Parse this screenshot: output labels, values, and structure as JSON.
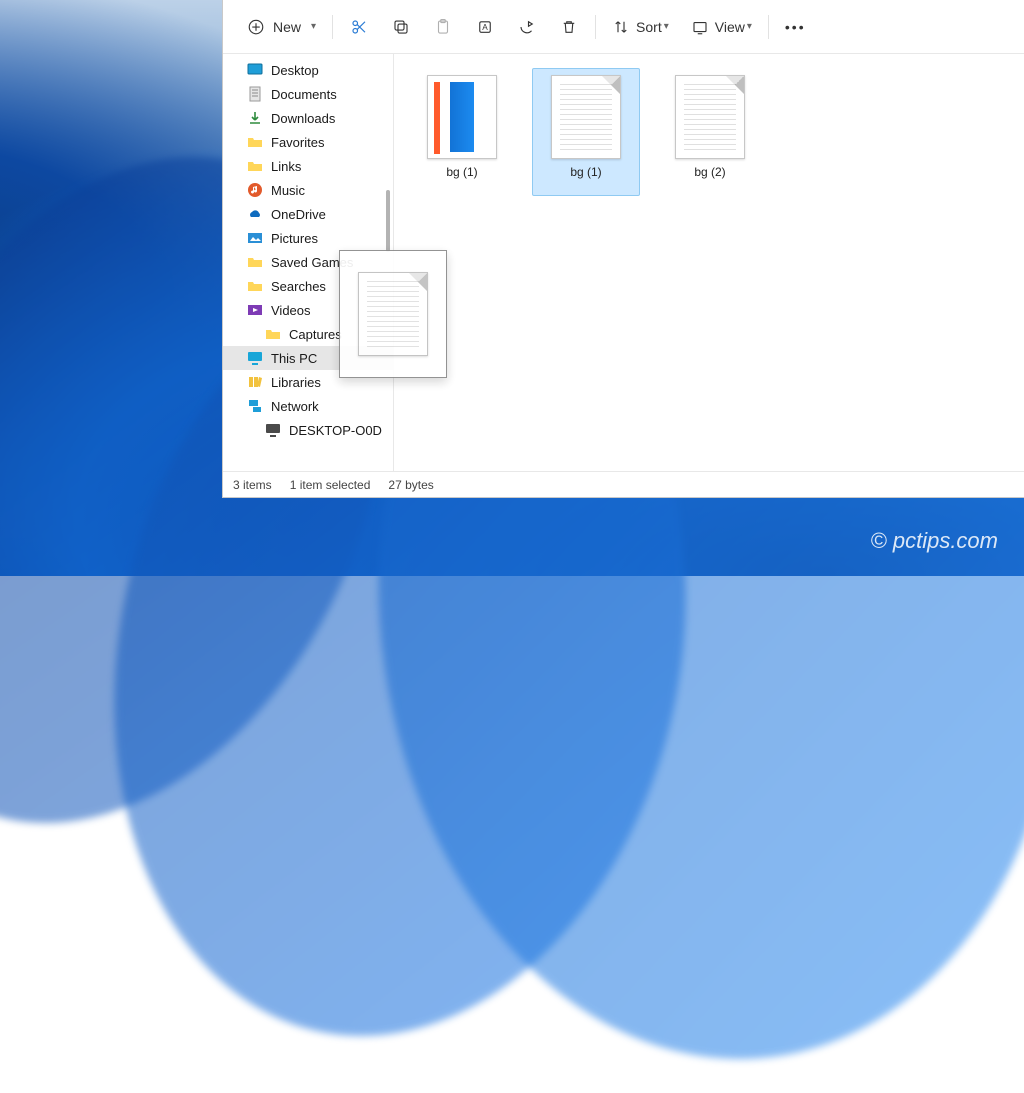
{
  "toolbar": {
    "new_label": "New",
    "sort_label": "Sort",
    "view_label": "View"
  },
  "sidebar": {
    "items": [
      {
        "label": "Desktop"
      },
      {
        "label": "Documents"
      },
      {
        "label": "Downloads"
      },
      {
        "label": "Favorites"
      },
      {
        "label": "Links"
      },
      {
        "label": "Music"
      },
      {
        "label": "OneDrive"
      },
      {
        "label": "Pictures"
      },
      {
        "label": "Saved Games"
      },
      {
        "label": "Searches"
      },
      {
        "label": "Videos"
      },
      {
        "label": "Captures"
      },
      {
        "label": "This PC"
      },
      {
        "label": "Libraries"
      },
      {
        "label": "Network"
      },
      {
        "label": "DESKTOP-O0D"
      }
    ]
  },
  "files": [
    {
      "name": "bg (1)"
    },
    {
      "name": "bg (1)"
    },
    {
      "name": "bg (2)"
    }
  ],
  "status": {
    "count": "3 items",
    "selection": "1 item selected",
    "size": "27 bytes"
  },
  "watermark": "© pctips.com"
}
